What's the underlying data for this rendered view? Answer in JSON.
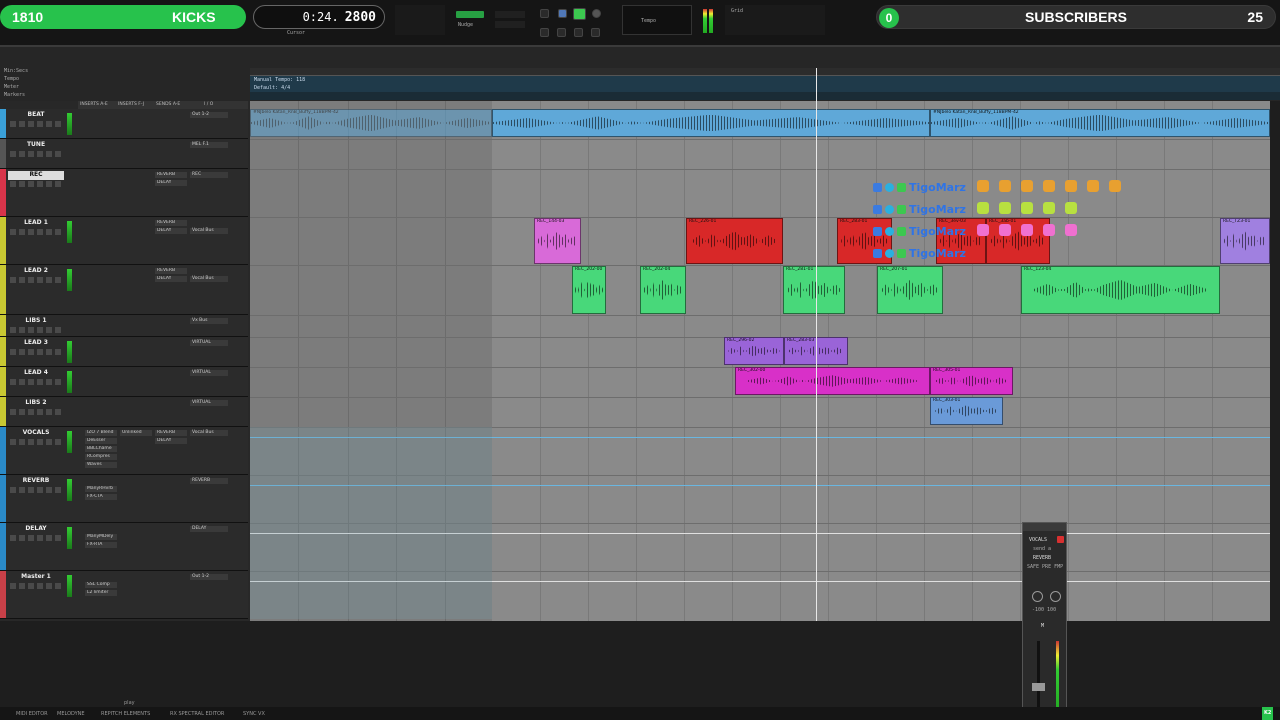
{
  "kicks": {
    "count": "1810",
    "label": "KICKS"
  },
  "subscribers": {
    "badge": "0",
    "label": "SUBSCRIBERS",
    "count": "25"
  },
  "counter": {
    "main": "0:24.",
    "sub": "2800"
  },
  "transport": {
    "nudge_label": "Nudge",
    "grid_label": "Grid",
    "tempo_label": "Tempo",
    "cursor_label": "Cursor"
  },
  "rulers": {
    "min_secs": "Min:Secs",
    "tempo": "Tempo",
    "meter": "Meter",
    "markers": "Markers",
    "manual_tempo": "Manual Tempo:",
    "manual_tempo_value": "118",
    "default": "Default: 4/4"
  },
  "header_cols": [
    "INSERTS A-E",
    "INSERTS F-J",
    "SENDS A-E",
    "I / O"
  ],
  "tracks": [
    {
      "name": "BEAT",
      "color": "#3aa0d8",
      "io": "Out 1-2"
    },
    {
      "name": "TUNE",
      "color": "#555555",
      "io": "MEL F.1"
    },
    {
      "name": "REC",
      "color": "#d8344a",
      "io": "REC"
    },
    {
      "name": "LEAD 1",
      "color": "#c8c832",
      "io": "Vocal Bus"
    },
    {
      "name": "LEAD 2",
      "color": "#c8c832",
      "io": "Vocal Bus"
    },
    {
      "name": "LIBS 1",
      "color": "#c8c832",
      "io": "Vx Bus"
    },
    {
      "name": "LEAD 3",
      "color": "#c8c832",
      "io": "VIRTUAL"
    },
    {
      "name": "LEAD 4",
      "color": "#c8c832",
      "io": "VIRTUAL"
    },
    {
      "name": "LIBS 2",
      "color": "#c8c832",
      "io": "VIRTUAL"
    },
    {
      "name": "VOCALS",
      "color": "#2a8ac8",
      "io": "Vocal Bus"
    },
    {
      "name": "REVERB",
      "color": "#2a8ac8",
      "io": "REVERB"
    },
    {
      "name": "DELAY",
      "color": "#2a8ac8",
      "io": "DELAY"
    },
    {
      "name": "Master 1",
      "color": "#c84048",
      "io": "Out 1-2"
    }
  ],
  "inserts": {
    "vocals": [
      "IZO 7 Blend",
      "DeEsser",
      "BBLChame",
      "RCompres",
      "Waves"
    ],
    "reverb": [
      "ManyRHvrb",
      "FX-CTA"
    ],
    "delay": [
      "ManyMDely",
      "FX-RTA"
    ],
    "master": [
      "SSL Comp",
      "L2 limiter"
    ]
  },
  "sends": {
    "rec": [
      "REVERB",
      "DELAY"
    ],
    "lead1": [
      "REVERB",
      "DELAY"
    ],
    "lead2": [
      "REVERB",
      "DELAY"
    ],
    "vocals": [
      "Unlinked",
      "REVERB",
      "DELAY"
    ]
  },
  "clips": {
    "beat_a": "#NJbelo Katan_RnB_Buffy_118BPM-42",
    "beat_b": "#NJbelo Katan_RnB_Buffy_118BPM-42",
    "lead1": [
      "REC_144-03",
      "REC_226-01",
      "REC_283-01",
      "REC_3ev-03",
      "REC_3ab-01",
      "REC_TZ3-01"
    ],
    "lead2": [
      "REC_202-00",
      "REC_202-04",
      "REC_281-01",
      "REC_207-01",
      "REC_123-04"
    ],
    "lead3": [
      "REC_296-02",
      "REC_283-03"
    ],
    "lead4": [
      "REC_302-00",
      "REC_305-01"
    ],
    "libs2": [
      "REC_303-01"
    ]
  },
  "chat": [
    {
      "user": "TigoMarz"
    },
    {
      "user": "TigoMarz"
    },
    {
      "user": "TigoMarz"
    },
    {
      "user": "TigoMarz"
    }
  ],
  "send_window": {
    "track": "VOCALS",
    "send": "send a",
    "dest": "REVERB",
    "labels": "SAFE PRE FMP",
    "values": "-100 100",
    "m": "M"
  },
  "bottombar": {
    "items": [
      "MIDI EDITOR",
      "MELODYNE",
      "REPITCH ELEMENTS",
      "RX SPECTRAL EDITOR",
      "SYNC VX"
    ],
    "play": "play",
    "k_badge": "K2"
  },
  "colors": {
    "green_pill": "#27c24c",
    "lead1_clip": "#d82828",
    "lead2_clip": "#48d87a",
    "lead3_clip": "#9a64d8",
    "lead4_clip": "#d830c8",
    "libs2_clip": "#6a9ad8",
    "pink_clip": "#d86ad8",
    "lavender_clip": "#a080e0"
  }
}
